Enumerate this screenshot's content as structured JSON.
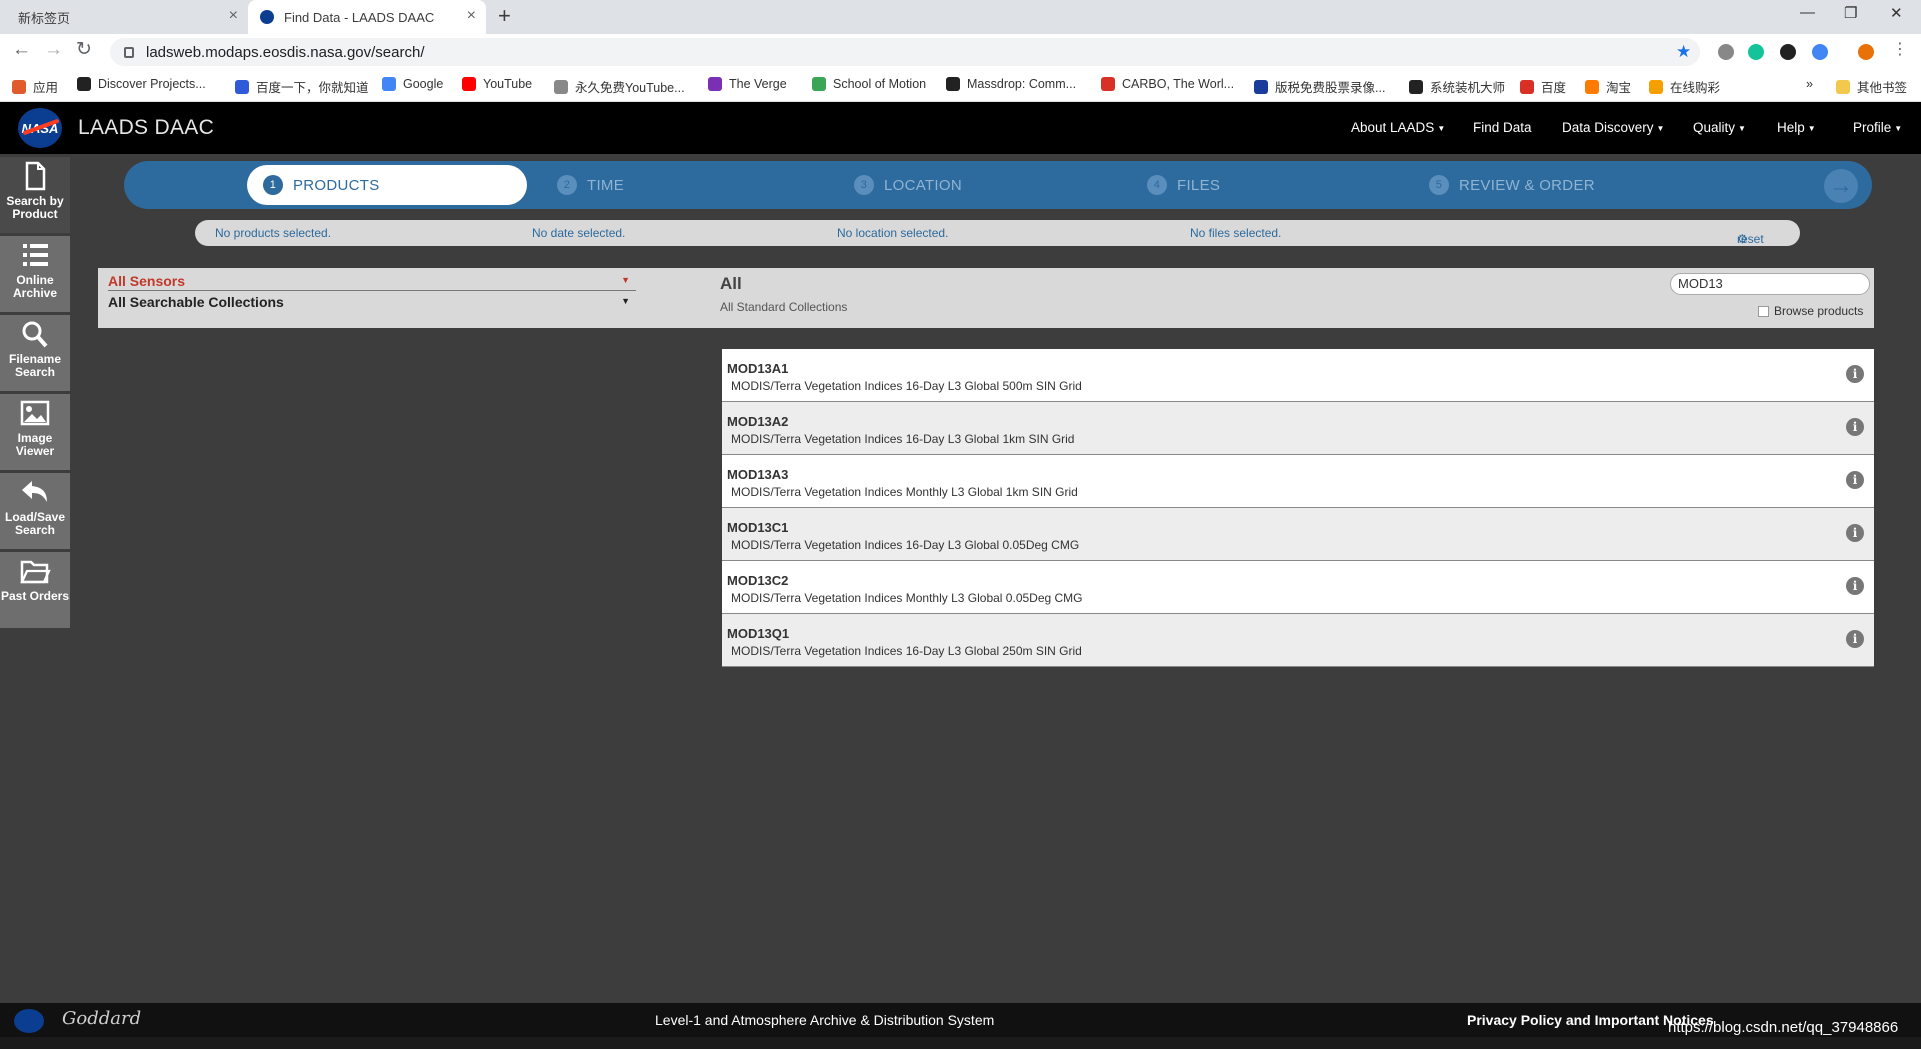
{
  "browser": {
    "tabs": [
      {
        "label": "新标签页",
        "active": false
      },
      {
        "label": "Find Data - LAADS DAAC",
        "active": true
      }
    ],
    "new_tab": "+",
    "url": "ladsweb.modaps.eosdis.nasa.gov/search/",
    "bookmarks": [
      {
        "label": "应用",
        "color": "#e05a2b"
      },
      {
        "label": "Discover Projects...",
        "color": "#222222"
      },
      {
        "label": "百度一下，你就知道",
        "color": "#2f5bd9"
      },
      {
        "label": "Google",
        "color": "#4285f4"
      },
      {
        "label": "YouTube",
        "color": "#ff0000"
      },
      {
        "label": "永久免费YouTube...",
        "color": "#888888"
      },
      {
        "label": "The Verge",
        "color": "#7b2fb5"
      },
      {
        "label": "School of Motion",
        "color": "#3aa655"
      },
      {
        "label": "Massdrop: Comm...",
        "color": "#222222"
      },
      {
        "label": "CARBO, The Worl...",
        "color": "#d93025"
      },
      {
        "label": "版税免费股票录像...",
        "color": "#1a3d9c"
      },
      {
        "label": "系统装机大师",
        "color": "#222222"
      },
      {
        "label": "百度",
        "color": "#d93025"
      },
      {
        "label": "淘宝",
        "color": "#ff7a00"
      },
      {
        "label": "在线购彩",
        "color": "#f5a000"
      }
    ],
    "bookmarks_more": "»",
    "other_bookmarks": "其他书签"
  },
  "header": {
    "logo": "NASA",
    "title": "LAADS DAAC",
    "nav": [
      {
        "label": "About LAADS",
        "dropdown": true
      },
      {
        "label": "Find Data",
        "dropdown": false
      },
      {
        "label": "Data Discovery",
        "dropdown": true
      },
      {
        "label": "Quality",
        "dropdown": true
      },
      {
        "label": "Help",
        "dropdown": true
      },
      {
        "label": "Profile",
        "dropdown": true
      }
    ]
  },
  "sidebar": {
    "items": [
      {
        "label": "Search by Product",
        "icon": "document-icon",
        "active": true
      },
      {
        "label": "Online Archive",
        "icon": "list-icon",
        "active": false
      },
      {
        "label": "Filename Search",
        "icon": "search-icon",
        "active": false
      },
      {
        "label": "Image Viewer",
        "icon": "image-icon",
        "active": false
      },
      {
        "label": "Load/Save Search",
        "icon": "reply-icon",
        "active": false
      },
      {
        "label": "Past Orders",
        "icon": "folder-icon",
        "active": false
      }
    ]
  },
  "wizard": {
    "steps": [
      {
        "num": "1",
        "label": "PRODUCTS",
        "active": true
      },
      {
        "num": "2",
        "label": "TIME",
        "active": false
      },
      {
        "num": "3",
        "label": "LOCATION",
        "active": false
      },
      {
        "num": "4",
        "label": "FILES",
        "active": false
      },
      {
        "num": "5",
        "label": "REVIEW & ORDER",
        "active": false
      }
    ],
    "next_icon": "→"
  },
  "summary": {
    "products": "No products selected.",
    "date": "No date selected.",
    "location": "No location selected.",
    "files": "No files selected.",
    "reset": "reset"
  },
  "filters": {
    "sensors": "All Sensors",
    "collections": "All Searchable Collections",
    "heading": "All",
    "subheading": "All Standard Collections",
    "search_value": "MOD13",
    "browse_label": "Browse products"
  },
  "results": [
    {
      "id": "MOD13A1",
      "desc": "MODIS/Terra Vegetation Indices 16-Day L3 Global 500m SIN Grid"
    },
    {
      "id": "MOD13A2",
      "desc": "MODIS/Terra Vegetation Indices 16-Day L3 Global 1km SIN Grid"
    },
    {
      "id": "MOD13A3",
      "desc": "MODIS/Terra Vegetation Indices Monthly L3 Global 1km SIN Grid"
    },
    {
      "id": "MOD13C1",
      "desc": "MODIS/Terra Vegetation Indices 16-Day L3 Global 0.05Deg CMG"
    },
    {
      "id": "MOD13C2",
      "desc": "MODIS/Terra Vegetation Indices Monthly L3 Global 0.05Deg CMG"
    },
    {
      "id": "MOD13Q1",
      "desc": "MODIS/Terra Vegetation Indices 16-Day L3 Global 250m SIN Grid"
    }
  ],
  "footer": {
    "center": "Level-1 and Atmosphere Archive & Distribution System",
    "privacy": "Privacy Policy and Important Notices",
    "goddard": "Goddard"
  },
  "watermark": "https://blog.csdn.net/qq_37948866"
}
